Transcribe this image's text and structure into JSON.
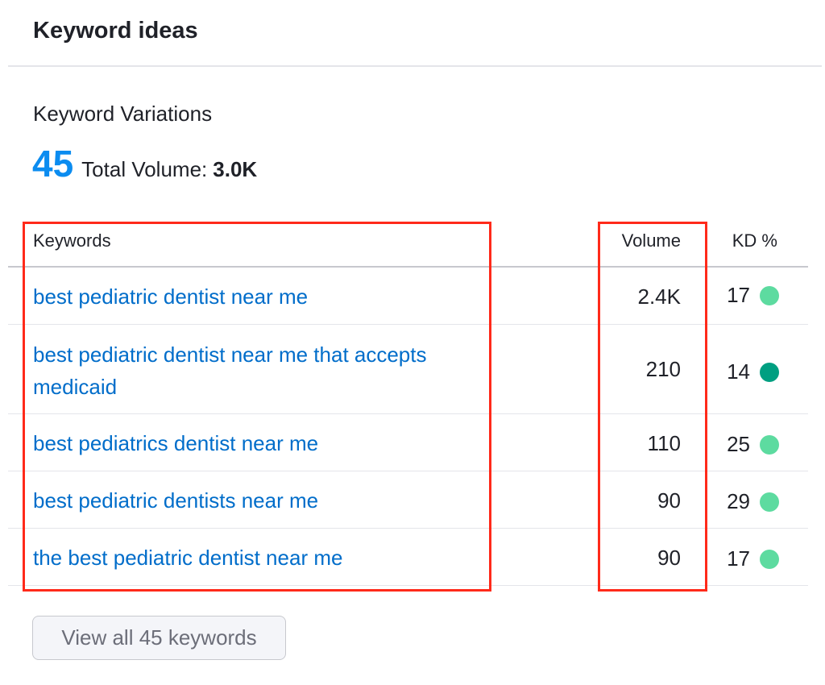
{
  "panel": {
    "title": "Keyword ideas"
  },
  "section": {
    "title": "Keyword Variations",
    "count": "45",
    "total_volume_label": "Total Volume:",
    "total_volume_value": "3.0K"
  },
  "table": {
    "headers": {
      "keywords": "Keywords",
      "volume": "Volume",
      "kd": "KD %"
    },
    "rows": [
      {
        "keyword": "best pediatric dentist near me",
        "volume": "2.4K",
        "kd": "17",
        "kd_color": "#5ddba0"
      },
      {
        "keyword": "best pediatric dentist near me that accepts medicaid",
        "volume": "210",
        "kd": "14",
        "kd_color": "#009f81"
      },
      {
        "keyword": "best pediatrics dentist near me",
        "volume": "110",
        "kd": "25",
        "kd_color": "#5ddba0"
      },
      {
        "keyword": "best pediatric dentists near me",
        "volume": "90",
        "kd": "29",
        "kd_color": "#5ddba0"
      },
      {
        "keyword": "the best pediatric dentist near me",
        "volume": "90",
        "kd": "17",
        "kd_color": "#5ddba0"
      }
    ]
  },
  "footer": {
    "view_all_label": "View all 45 keywords"
  },
  "colors": {
    "accent": "#0b8cf0",
    "link": "#006dca",
    "highlight": "#ff2a1a"
  }
}
